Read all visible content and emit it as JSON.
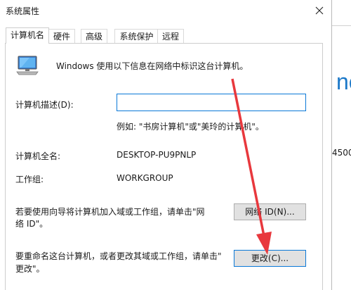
{
  "window": {
    "title": "系统属性",
    "close_icon": "close-icon"
  },
  "tabs": [
    {
      "label": "计算机名",
      "active": true
    },
    {
      "label": "硬件",
      "active": false
    },
    {
      "label": "高级",
      "active": false
    },
    {
      "label": "系统保护",
      "active": false
    },
    {
      "label": "远程",
      "active": false
    }
  ],
  "panel": {
    "info_text": "Windows 使用以下信息在网络中标识这台计算机。",
    "description_label": "计算机描述(D):",
    "description_value": "",
    "example_text": "例如: \"书房计算机\"或\"美玲的计算机\"。",
    "fullname_label": "计算机全名:",
    "fullname_value": "DESKTOP-PU9PNLP",
    "workgroup_label": "工作组:",
    "workgroup_value": "WORKGROUP",
    "network_text_line1": "若要使用向导将计算机加入域或工作组，请单击\"网",
    "network_text_line2": "络 ID\"。",
    "network_button": "网络 ID(N)...",
    "rename_text_line1": "要重命名这台计算机，或者更改其域或工作组，请单击\"",
    "rename_text_line2": "更改\"。",
    "change_button": "更改(C)..."
  },
  "background": {
    "right_text": "nc",
    "right_number": "4500"
  },
  "colors": {
    "accent": "#0a78d7",
    "annotation_arrow": "#e8383d"
  }
}
